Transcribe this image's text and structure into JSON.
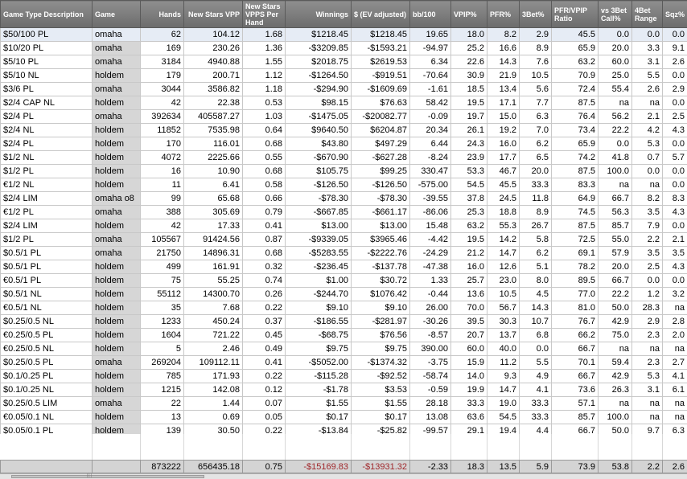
{
  "columns": [
    {
      "key": "desc",
      "label": "Game Type Description"
    },
    {
      "key": "game",
      "label": "Game"
    },
    {
      "key": "hands",
      "label": "Hands"
    },
    {
      "key": "vpp",
      "label": "New Stars VPP"
    },
    {
      "key": "vpph",
      "label": "New Stars VPPS Per Hand"
    },
    {
      "key": "win",
      "label": "Winnings"
    },
    {
      "key": "ev",
      "label": "$ (EV adjusted)"
    },
    {
      "key": "bb",
      "label": "bb/100"
    },
    {
      "key": "vpip",
      "label": "VPIP%"
    },
    {
      "key": "pfr",
      "label": "PFR%"
    },
    {
      "key": "bet3",
      "label": "3Bet%"
    },
    {
      "key": "ratio",
      "label": "PFR/VPIP Ratio"
    },
    {
      "key": "call3",
      "label": "vs 3Bet Call%"
    },
    {
      "key": "bet4",
      "label": "4Bet Range"
    },
    {
      "key": "sqz",
      "label": "Sqz%"
    }
  ],
  "rows": [
    [
      "$50/100 PL",
      "omaha",
      "62",
      "104.12",
      "1.68",
      "$1218.45",
      "$1218.45",
      "19.65",
      "18.0",
      "8.2",
      "2.9",
      "45.5",
      "0.0",
      "0.0",
      "0.0"
    ],
    [
      "$10/20 PL",
      "omaha",
      "169",
      "230.26",
      "1.36",
      "-$3209.85",
      "-$1593.21",
      "-94.97",
      "25.2",
      "16.6",
      "8.9",
      "65.9",
      "20.0",
      "3.3",
      "9.1"
    ],
    [
      "$5/10 PL",
      "omaha",
      "3184",
      "4940.88",
      "1.55",
      "$2018.75",
      "$2619.53",
      "6.34",
      "22.6",
      "14.3",
      "7.6",
      "63.2",
      "60.0",
      "3.1",
      "2.6"
    ],
    [
      "$5/10 NL",
      "holdem",
      "179",
      "200.71",
      "1.12",
      "-$1264.50",
      "-$919.51",
      "-70.64",
      "30.9",
      "21.9",
      "10.5",
      "70.9",
      "25.0",
      "5.5",
      "0.0"
    ],
    [
      "$3/6 PL",
      "omaha",
      "3044",
      "3586.82",
      "1.18",
      "-$294.90",
      "-$1609.69",
      "-1.61",
      "18.5",
      "13.4",
      "5.6",
      "72.4",
      "55.4",
      "2.6",
      "2.9"
    ],
    [
      "$2/4 CAP NL",
      "holdem",
      "42",
      "22.38",
      "0.53",
      "$98.15",
      "$76.63",
      "58.42",
      "19.5",
      "17.1",
      "7.7",
      "87.5",
      "na",
      "na",
      "0.0"
    ],
    [
      "$2/4 PL",
      "omaha",
      "392634",
      "405587.27",
      "1.03",
      "-$1475.05",
      "-$20082.77",
      "-0.09",
      "19.7",
      "15.0",
      "6.3",
      "76.4",
      "56.2",
      "2.1",
      "2.5"
    ],
    [
      "$2/4 NL",
      "holdem",
      "11852",
      "7535.98",
      "0.64",
      "$9640.50",
      "$6204.87",
      "20.34",
      "26.1",
      "19.2",
      "7.0",
      "73.4",
      "22.2",
      "4.2",
      "4.3"
    ],
    [
      "$2/4 PL",
      "holdem",
      "170",
      "116.01",
      "0.68",
      "$43.80",
      "$497.29",
      "6.44",
      "24.3",
      "16.0",
      "6.2",
      "65.9",
      "0.0",
      "5.3",
      "0.0"
    ],
    [
      "$1/2 NL",
      "holdem",
      "4072",
      "2225.66",
      "0.55",
      "-$670.90",
      "-$627.28",
      "-8.24",
      "23.9",
      "17.7",
      "6.5",
      "74.2",
      "41.8",
      "0.7",
      "5.7"
    ],
    [
      "$1/2 PL",
      "holdem",
      "16",
      "10.90",
      "0.68",
      "$105.75",
      "$99.25",
      "330.47",
      "53.3",
      "46.7",
      "20.0",
      "87.5",
      "100.0",
      "0.0",
      "0.0"
    ],
    [
      "€1/2 NL",
      "holdem",
      "11",
      "6.41",
      "0.58",
      "-$126.50",
      "-$126.50",
      "-575.00",
      "54.5",
      "45.5",
      "33.3",
      "83.3",
      "na",
      "na",
      "0.0"
    ],
    [
      "$2/4 LIM",
      "omaha o8",
      "99",
      "65.68",
      "0.66",
      "-$78.30",
      "-$78.30",
      "-39.55",
      "37.8",
      "24.5",
      "11.8",
      "64.9",
      "66.7",
      "8.2",
      "8.3"
    ],
    [
      "€1/2 PL",
      "omaha",
      "388",
      "305.69",
      "0.79",
      "-$667.85",
      "-$661.17",
      "-86.06",
      "25.3",
      "18.8",
      "8.9",
      "74.5",
      "56.3",
      "3.5",
      "4.3"
    ],
    [
      "$2/4 LIM",
      "holdem",
      "42",
      "17.33",
      "0.41",
      "$13.00",
      "$13.00",
      "15.48",
      "63.2",
      "55.3",
      "26.7",
      "87.5",
      "85.7",
      "7.9",
      "0.0"
    ],
    [
      "$1/2 PL",
      "omaha",
      "105567",
      "91424.56",
      "0.87",
      "-$9339.05",
      "$3965.46",
      "-4.42",
      "19.5",
      "14.2",
      "5.8",
      "72.5",
      "55.0",
      "2.2",
      "2.1"
    ],
    [
      "$0.5/1 PL",
      "omaha",
      "21750",
      "14896.31",
      "0.68",
      "-$5283.55",
      "-$2222.76",
      "-24.29",
      "21.2",
      "14.7",
      "6.2",
      "69.1",
      "57.9",
      "3.5",
      "3.5"
    ],
    [
      "$0.5/1 PL",
      "holdem",
      "499",
      "161.91",
      "0.32",
      "-$236.45",
      "-$137.78",
      "-47.38",
      "16.0",
      "12.6",
      "5.1",
      "78.2",
      "20.0",
      "2.5",
      "4.3"
    ],
    [
      "€0.5/1 PL",
      "holdem",
      "75",
      "55.25",
      "0.74",
      "$1.00",
      "$30.72",
      "1.33",
      "25.7",
      "23.0",
      "8.0",
      "89.5",
      "66.7",
      "0.0",
      "0.0"
    ],
    [
      "$0.5/1 NL",
      "holdem",
      "55112",
      "14300.70",
      "0.26",
      "-$244.70",
      "$1076.42",
      "-0.44",
      "13.6",
      "10.5",
      "4.5",
      "77.0",
      "22.2",
      "1.2",
      "3.2"
    ],
    [
      "€0.5/1 NL",
      "holdem",
      "35",
      "7.68",
      "0.22",
      "$9.10",
      "$9.10",
      "26.00",
      "70.0",
      "56.7",
      "14.3",
      "81.0",
      "50.0",
      "28.3",
      "na"
    ],
    [
      "$0.25/0.5 NL",
      "holdem",
      "1233",
      "450.24",
      "0.37",
      "-$186.55",
      "-$281.97",
      "-30.26",
      "39.5",
      "30.3",
      "10.7",
      "76.7",
      "42.9",
      "2.9",
      "2.8"
    ],
    [
      "€0.25/0.5 PL",
      "holdem",
      "1604",
      "721.22",
      "0.45",
      "-$68.75",
      "$76.56",
      "-8.57",
      "20.7",
      "13.7",
      "6.8",
      "66.2",
      "75.0",
      "2.3",
      "2.0"
    ],
    [
      "€0.25/0.5 NL",
      "holdem",
      "5",
      "2.46",
      "0.49",
      "$9.75",
      "$9.75",
      "390.00",
      "60.0",
      "40.0",
      "0.0",
      "66.7",
      "na",
      "na",
      "na"
    ],
    [
      "$0.25/0.5 PL",
      "omaha",
      "269204",
      "109112.11",
      "0.41",
      "-$5052.00",
      "-$1374.32",
      "-3.75",
      "15.9",
      "11.2",
      "5.5",
      "70.1",
      "59.4",
      "2.3",
      "2.7"
    ],
    [
      "$0.1/0.25 PL",
      "holdem",
      "785",
      "171.93",
      "0.22",
      "-$115.28",
      "-$92.52",
      "-58.74",
      "14.0",
      "9.3",
      "4.9",
      "66.7",
      "42.9",
      "5.3",
      "4.1"
    ],
    [
      "$0.1/0.25 NL",
      "holdem",
      "1215",
      "142.08",
      "0.12",
      "-$1.78",
      "$3.53",
      "-0.59",
      "19.9",
      "14.7",
      "4.1",
      "73.6",
      "26.3",
      "3.1",
      "6.1"
    ],
    [
      "$0.25/0.5 LIM",
      "omaha",
      "22",
      "1.44",
      "0.07",
      "$1.55",
      "$1.55",
      "28.18",
      "33.3",
      "19.0",
      "33.3",
      "57.1",
      "na",
      "na",
      "na"
    ],
    [
      "€0.05/0.1 NL",
      "holdem",
      "13",
      "0.69",
      "0.05",
      "$0.17",
      "$0.17",
      "13.08",
      "63.6",
      "54.5",
      "33.3",
      "85.7",
      "100.0",
      "na",
      "na"
    ],
    [
      "$0.05/0.1 PL",
      "holdem",
      "139",
      "30.50",
      "0.22",
      "-$13.84",
      "-$25.82",
      "-99.57",
      "29.1",
      "19.4",
      "4.4",
      "66.7",
      "50.0",
      "9.7",
      "6.3"
    ]
  ],
  "totals": [
    "",
    "",
    "873222",
    "656435.18",
    "0.75",
    "-$15169.83",
    "-$13931.32",
    "-2.33",
    "18.3",
    "13.5",
    "5.9",
    "73.9",
    "53.8",
    "2.2",
    "2.6"
  ],
  "colors": {
    "positive": "#2a7a2a",
    "negative": "#a0282c",
    "header": "#7a7a7a",
    "selected_row": "#e6ecf5"
  }
}
